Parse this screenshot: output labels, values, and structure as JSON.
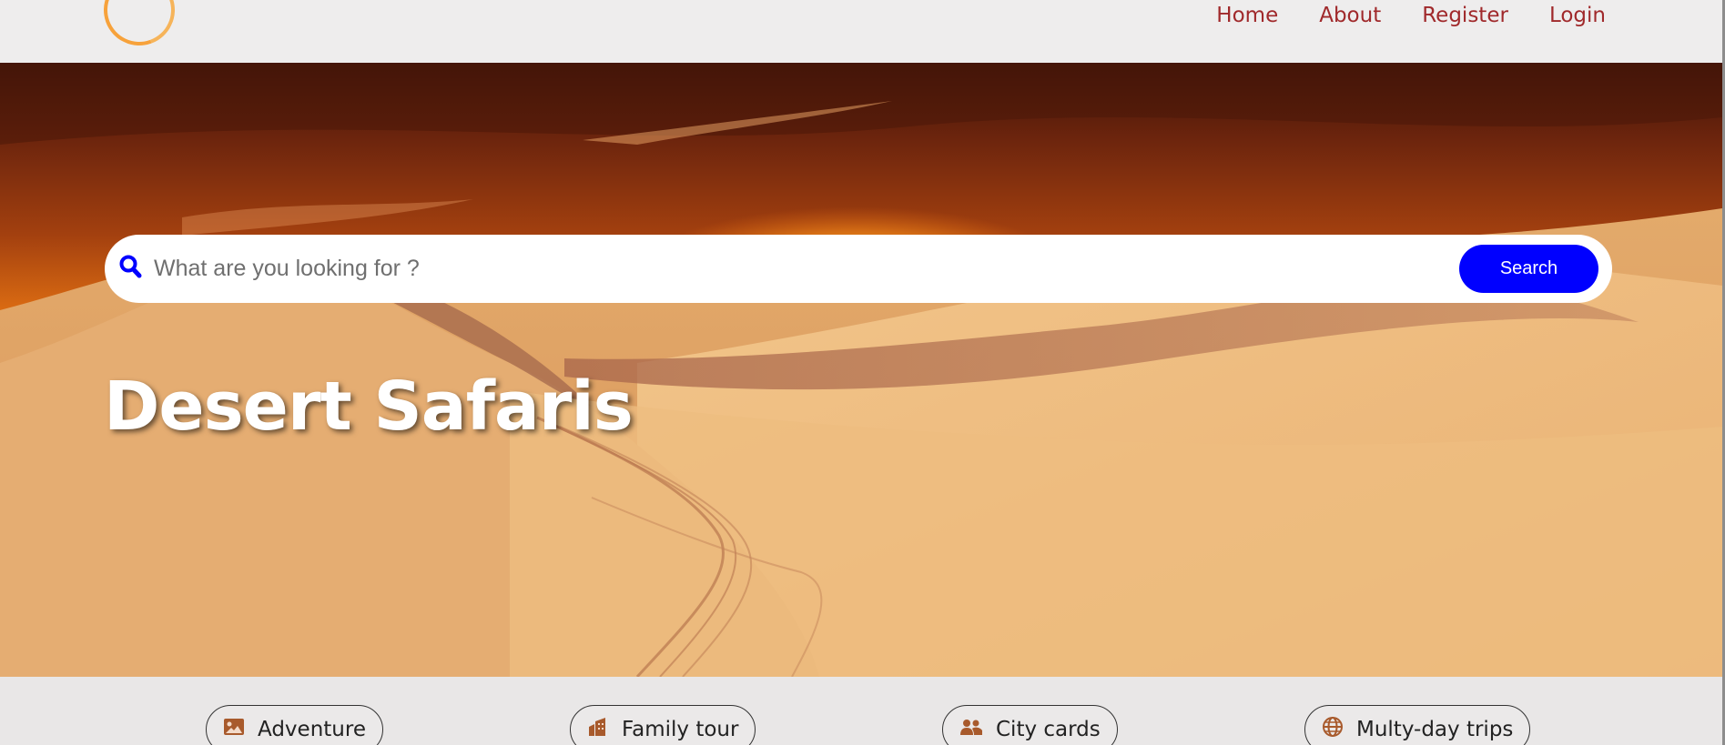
{
  "nav": {
    "items": [
      "Home",
      "About",
      "Register",
      "Login"
    ]
  },
  "search": {
    "placeholder": "What are you looking for ?",
    "value": "",
    "button_label": "Search"
  },
  "hero": {
    "title": "Desert Safaris"
  },
  "categories": [
    {
      "label": "Adventure",
      "icon": "image-icon"
    },
    {
      "label": "Family tour",
      "icon": "building-icon"
    },
    {
      "label": "City cards",
      "icon": "users-icon"
    },
    {
      "label": "Multy-day trips",
      "icon": "globe-icon"
    }
  ],
  "colors": {
    "nav_text": "#a0292b",
    "search_button": "#0000ff",
    "category_icon": "#a85a2c",
    "logo_ring": "#f7a23b"
  }
}
